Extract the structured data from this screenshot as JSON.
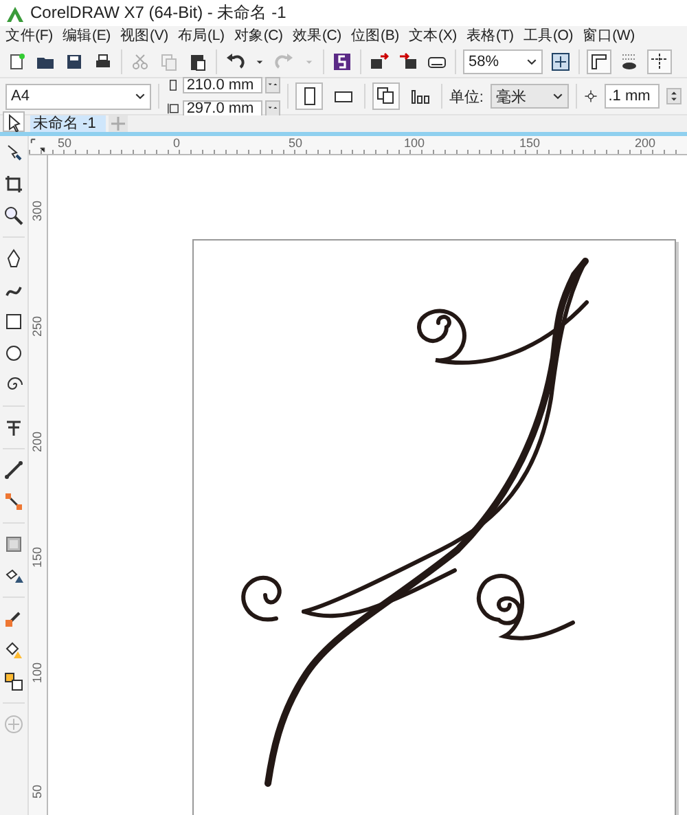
{
  "window": {
    "title": "CorelDRAW X7 (64-Bit) - 未命名 -1"
  },
  "menu": [
    "文件(F)",
    "编辑(E)",
    "视图(V)",
    "布局(L)",
    "对象(C)",
    "效果(C)",
    "位图(B)",
    "文本(X)",
    "表格(T)",
    "工具(O)",
    "窗口(W)"
  ],
  "toolbar": {
    "zoom": "58%"
  },
  "property_bar": {
    "paper": "A4",
    "width": "210.0 mm",
    "height": "297.0 mm",
    "unit_label": "单位:",
    "unit": "毫米",
    "nudge": ".1 mm"
  },
  "tabs": [
    {
      "label": "未命名 -1",
      "selected": true
    }
  ],
  "rulers": {
    "horizontal": [
      "50",
      "0",
      "50",
      "100",
      "150",
      "200"
    ],
    "vertical": [
      "300",
      "250",
      "200",
      "150",
      "100",
      "50"
    ]
  }
}
